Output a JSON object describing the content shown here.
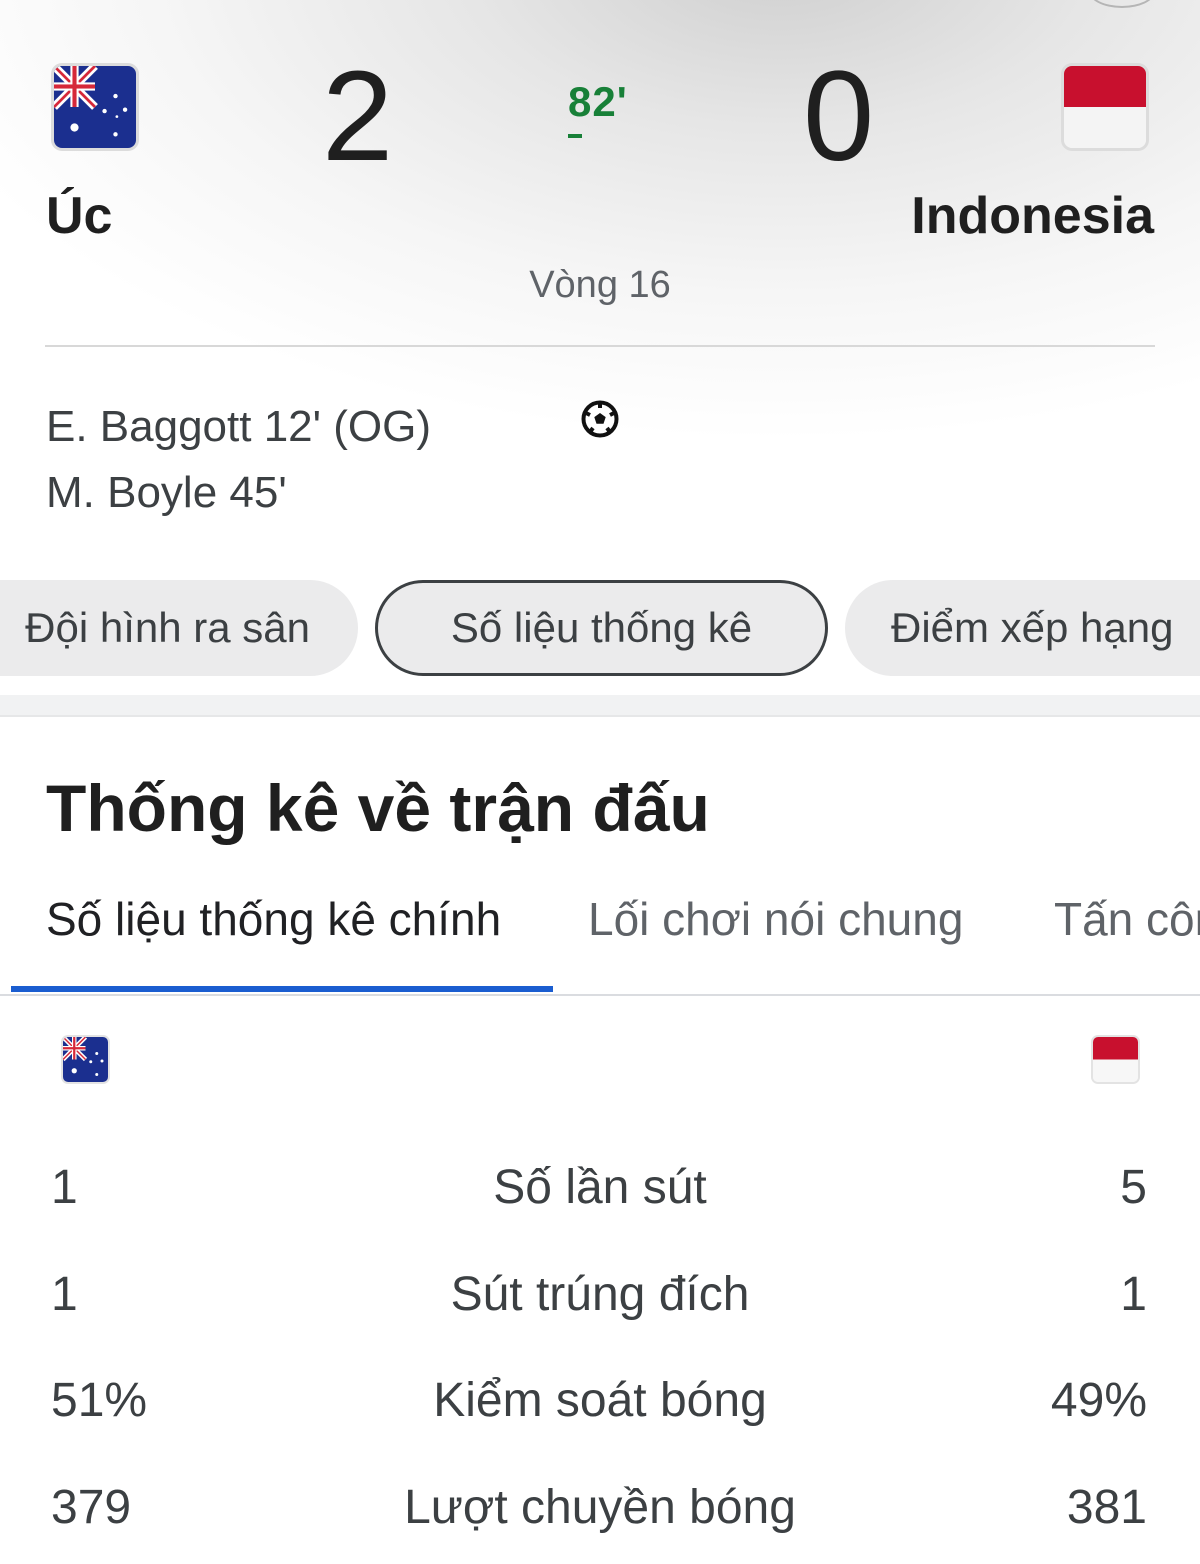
{
  "match": {
    "home": {
      "name": "Úc",
      "score": "2",
      "flag": "australia-flag"
    },
    "away": {
      "name": "Indonesia",
      "score": "0",
      "flag": "indonesia-flag"
    },
    "minute": "82'",
    "round": "Vòng 16",
    "status_color": "#188038",
    "scorers_home": [
      "E. Baggott 12' (OG)",
      "M. Boyle 45'"
    ],
    "goal_icon": "soccer-ball-icon"
  },
  "chips": [
    {
      "label": "Đội hình ra sân",
      "selected": false
    },
    {
      "label": "Số liệu thống kê",
      "selected": true
    },
    {
      "label": "Điểm xếp hạng",
      "selected": false
    }
  ],
  "stats": {
    "title": "Thống kê về trận đấu",
    "tabs": [
      {
        "label": "Số liệu thống kê chính",
        "active": true
      },
      {
        "label": "Lối chơi nói chung",
        "active": false
      },
      {
        "label": "Tấn công",
        "active": false
      }
    ],
    "accent_color": "#1a5dd0",
    "rows": [
      {
        "label": "Số lần sút",
        "home": "1",
        "away": "5"
      },
      {
        "label": "Sút trúng đích",
        "home": "1",
        "away": "1"
      },
      {
        "label": "Kiểm soát bóng",
        "home": "51%",
        "away": "49%"
      },
      {
        "label": "Lượt chuyền bóng",
        "home": "379",
        "away": "381"
      }
    ]
  }
}
